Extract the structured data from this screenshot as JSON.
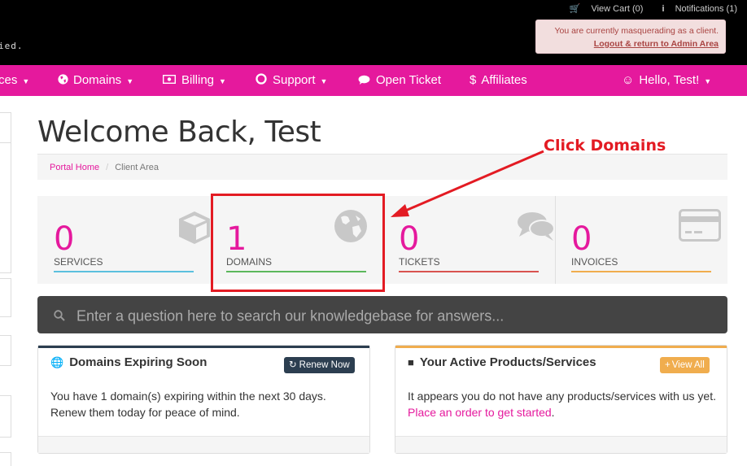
{
  "header": {
    "logo_fragment": "ied.",
    "view_cart": "View Cart (0)",
    "notifications": "Notifications (1)",
    "masquerade_text": "You are currently masquerading as a client.",
    "masquerade_link": "Logout & return to Admin Area"
  },
  "nav": {
    "services": "ces",
    "domains": "Domains",
    "billing": "Billing",
    "support": "Support",
    "open_ticket": "Open Ticket",
    "affiliates": "Affiliates",
    "user": "Hello, Test!"
  },
  "page": {
    "title": "Welcome Back, Test",
    "breadcrumb_home": "Portal Home",
    "breadcrumb_current": "Client Area"
  },
  "annotation": {
    "text": "Click Domains"
  },
  "tiles": [
    {
      "count": "0",
      "label": "SERVICES",
      "color": "#5bc0de",
      "icon": "cube-icon"
    },
    {
      "count": "1",
      "label": "DOMAINS",
      "color": "#5cb85c",
      "icon": "globe-icon"
    },
    {
      "count": "0",
      "label": "TICKETS",
      "color": "#d9534f",
      "icon": "comments-icon"
    },
    {
      "count": "0",
      "label": "INVOICES",
      "color": "#f0ad4e",
      "icon": "credit-card-icon"
    }
  ],
  "search": {
    "placeholder": "Enter a question here to search our knowledgebase for answers..."
  },
  "panels": {
    "domains": {
      "title": "Domains Expiring Soon",
      "button": "Renew Now",
      "body": "You have 1 domain(s) expiring within the next 30 days. Renew them today for peace of mind.",
      "accent": "#2c3e50"
    },
    "products": {
      "title": "Your Active Products/Services",
      "button": "View All",
      "body_prefix": "It appears you do not have any products/services with us yet. ",
      "body_link": "Place an order to get started",
      "body_suffix": ".",
      "accent": "#f0ad4e"
    }
  },
  "colors": {
    "brand": "#e5199d",
    "annotation": "#e31b23"
  }
}
